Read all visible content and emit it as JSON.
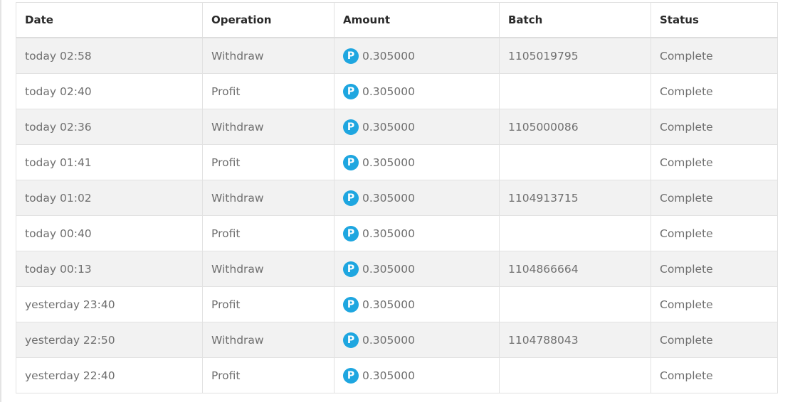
{
  "table": {
    "headers": [
      "Date",
      "Operation",
      "Amount",
      "Batch",
      "Status"
    ],
    "coin_icon": "p-coin-icon",
    "coin_glyph": "P",
    "accent_color": "#1ea6e0",
    "rows": [
      {
        "date": "today 02:58",
        "operation": "Withdraw",
        "amount": "0.305000",
        "batch": "1105019795",
        "status": "Complete"
      },
      {
        "date": "today 02:40",
        "operation": "Profit",
        "amount": "0.305000",
        "batch": "",
        "status": "Complete"
      },
      {
        "date": "today 02:36",
        "operation": "Withdraw",
        "amount": "0.305000",
        "batch": "1105000086",
        "status": "Complete"
      },
      {
        "date": "today 01:41",
        "operation": "Profit",
        "amount": "0.305000",
        "batch": "",
        "status": "Complete"
      },
      {
        "date": "today 01:02",
        "operation": "Withdraw",
        "amount": "0.305000",
        "batch": "1104913715",
        "status": "Complete"
      },
      {
        "date": "today 00:40",
        "operation": "Profit",
        "amount": "0.305000",
        "batch": "",
        "status": "Complete"
      },
      {
        "date": "today 00:13",
        "operation": "Withdraw",
        "amount": "0.305000",
        "batch": "1104866664",
        "status": "Complete"
      },
      {
        "date": "yesterday 23:40",
        "operation": "Profit",
        "amount": "0.305000",
        "batch": "",
        "status": "Complete"
      },
      {
        "date": "yesterday 22:50",
        "operation": "Withdraw",
        "amount": "0.305000",
        "batch": "1104788043",
        "status": "Complete"
      },
      {
        "date": "yesterday 22:40",
        "operation": "Profit",
        "amount": "0.305000",
        "batch": "",
        "status": "Complete"
      }
    ]
  }
}
